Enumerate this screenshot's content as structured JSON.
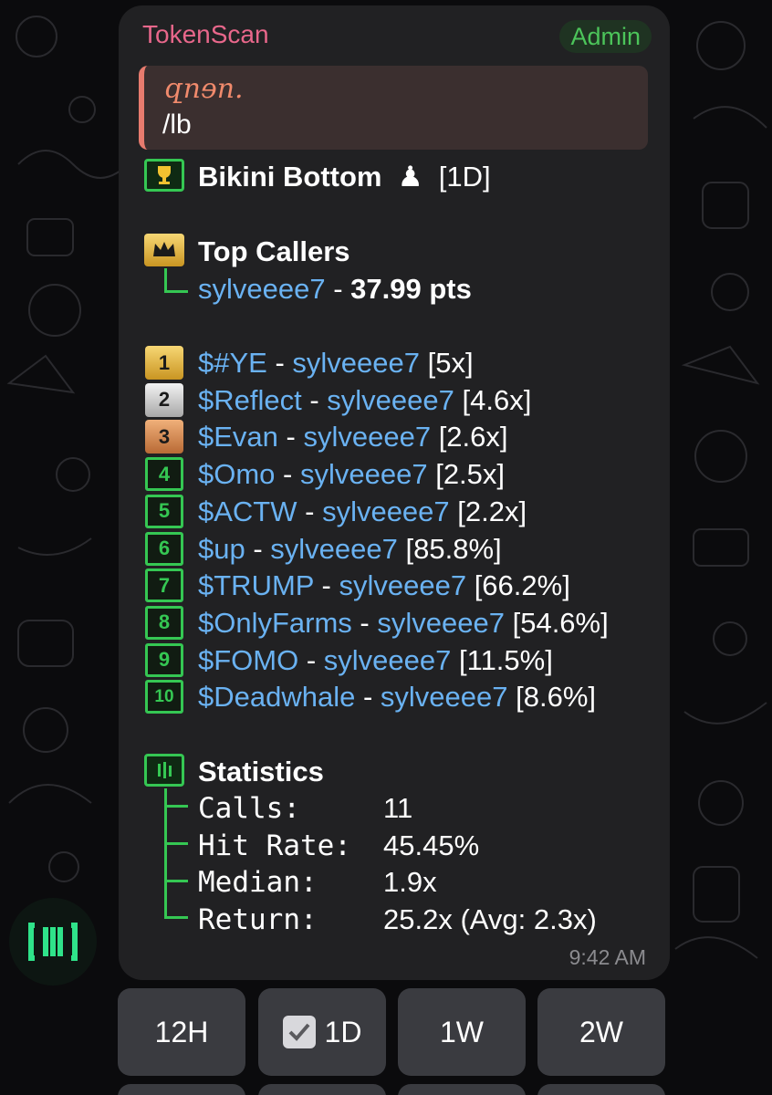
{
  "message": {
    "sender": "TokenScan",
    "badge": "Admin",
    "reply_author": " զnɘn.",
    "reply_text": "/lb",
    "group_line": {
      "name": "Bikini Bottom",
      "suffix": "[1D]",
      "icon": "pawn-icon"
    },
    "top_callers": {
      "heading": "Top Callers",
      "user": "sylveeee7",
      "sep": " - ",
      "points": "37.99 pts"
    },
    "leaderboard": [
      {
        "rank": "1",
        "token": "$#YE",
        "caller": "sylveeee7",
        "mult": "[5x]"
      },
      {
        "rank": "2",
        "token": "$Reflect",
        "caller": "sylveeee7",
        "mult": "[4.6x]"
      },
      {
        "rank": "3",
        "token": "$Evan",
        "caller": "sylveeee7",
        "mult": "[2.6x]"
      },
      {
        "rank": "4",
        "token": "$Omo",
        "caller": "sylveeee7",
        "mult": "[2.5x]"
      },
      {
        "rank": "5",
        "token": "$ACTW",
        "caller": "sylveeee7",
        "mult": "[2.2x]"
      },
      {
        "rank": "6",
        "token": "$up",
        "caller": "sylveeee7",
        "mult": "[85.8%]"
      },
      {
        "rank": "7",
        "token": "$TRUMP",
        "caller": "sylveeee7",
        "mult": "[66.2%]"
      },
      {
        "rank": "8",
        "token": "$OnlyFarms",
        "caller": "sylveeee7",
        "mult": "[54.6%]"
      },
      {
        "rank": "9",
        "token": "$FOMO",
        "caller": "sylveeee7",
        "mult": "[11.5%]"
      },
      {
        "rank": "10",
        "token": "$Deadwhale",
        "caller": "sylveeee7",
        "mult": "[8.6%]"
      }
    ],
    "separator": " - ",
    "statistics": {
      "heading": "Statistics",
      "rows": [
        {
          "label": "Calls:",
          "value": "11"
        },
        {
          "label": "Hit Rate:",
          "value": "45.45%"
        },
        {
          "label": "Median:",
          "value": "1.9x"
        },
        {
          "label": "Return:",
          "value": "25.2x (Avg: 2.3x)"
        }
      ]
    },
    "time": "9:42 AM"
  },
  "keyboard": {
    "buttons": [
      {
        "label": "12H",
        "selected": false
      },
      {
        "label": "1D",
        "selected": true
      },
      {
        "label": "1W",
        "selected": false
      },
      {
        "label": "2W",
        "selected": false
      }
    ]
  },
  "colors": {
    "accent_green": "#35c753",
    "link": "#6ab2f2",
    "sender": "#e8678b",
    "bubble": "#212123"
  }
}
